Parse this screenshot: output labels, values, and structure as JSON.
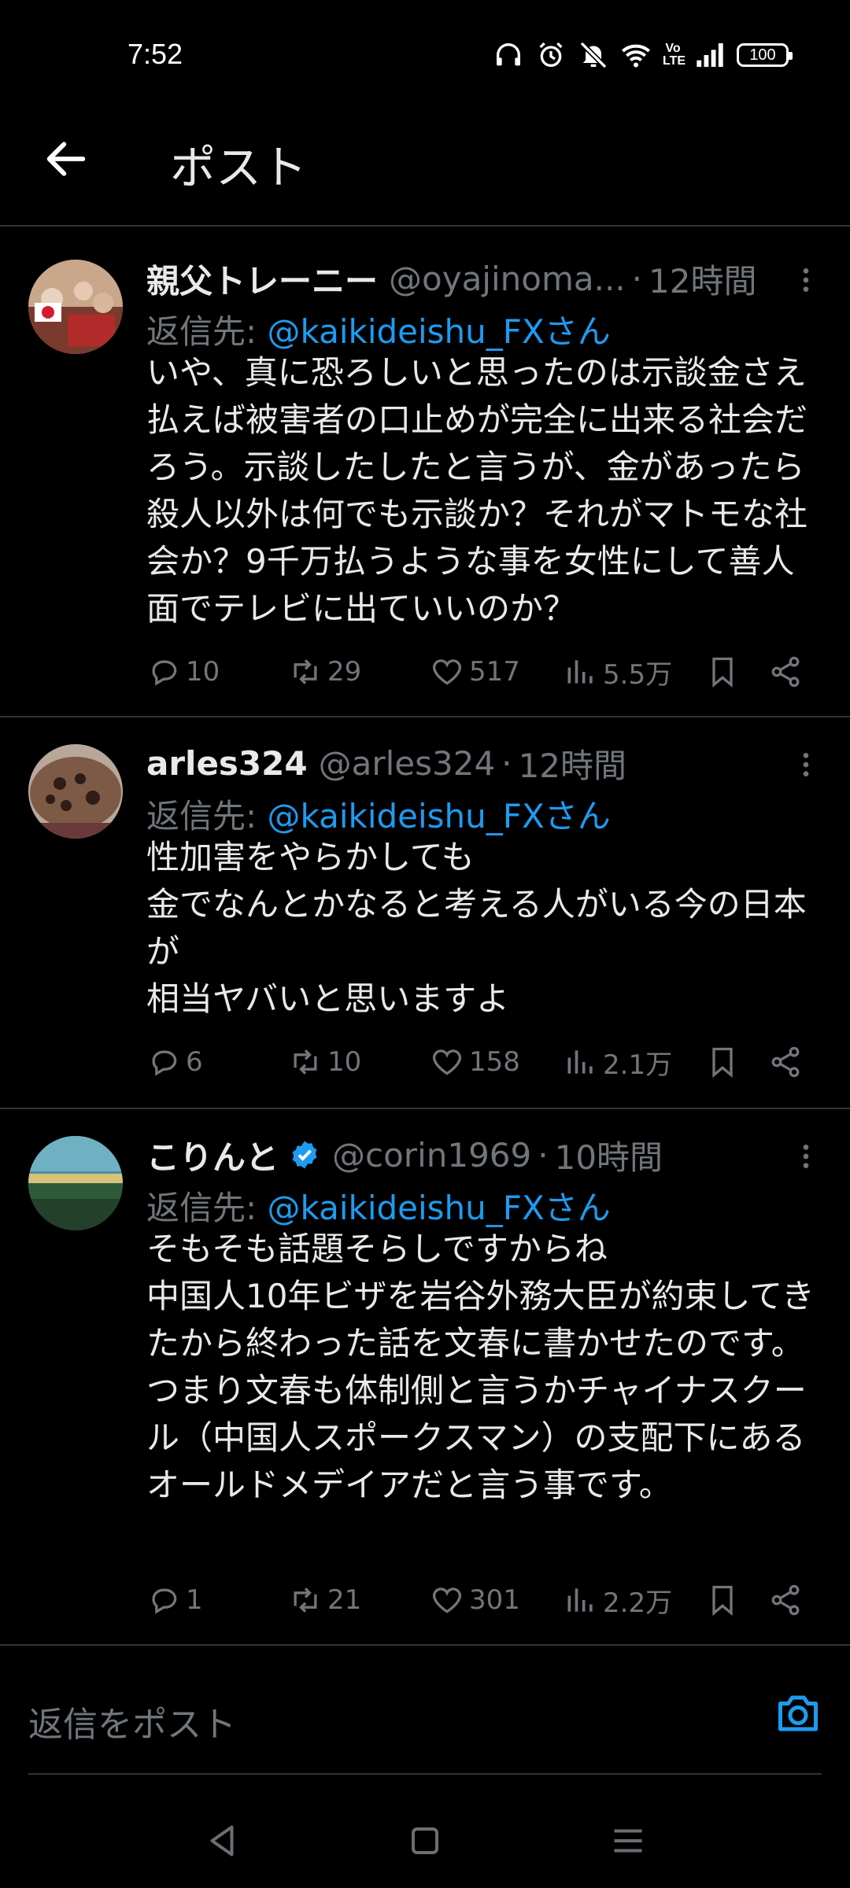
{
  "status_bar": {
    "time": "7:52",
    "volte": "Vo LTE",
    "battery": "100",
    "icons": [
      "headphones-icon",
      "alarm-icon",
      "mute-icon",
      "wifi-icon",
      "volte-icon",
      "signal-icon",
      "battery-icon"
    ]
  },
  "header": {
    "title": "ポスト",
    "back_icon": "arrow-left-icon"
  },
  "posts": [
    {
      "name": "親父トレーニー",
      "handle": "@oyajinoma...",
      "dot": "·",
      "time": "12時間",
      "reply_prefix": "返信先: ",
      "reply_to": "@kaikideishu_FXさん",
      "text": "いや、真に恐ろしいと思ったのは示談金さえ払えば被害者の口止めが完全に出来る社会だろう。示談したしたと言うが、金があったら殺人以外は何でも示談か？それがマトモな社会か？9千万払うような事を女性にして善人面でテレビに出ていいのか？",
      "replies": "10",
      "reposts": "29",
      "likes": "517",
      "views": "5.5万"
    },
    {
      "name": "arles324",
      "handle": "@arles324",
      "dot": "·",
      "time": "12時間",
      "reply_prefix": "返信先: ",
      "reply_to": "@kaikideishu_FXさん",
      "text": "性加害をやらかしても\n金でなんとかなると考える人がいる今の日本が\n相当ヤバいと思いますよ",
      "replies": "6",
      "reposts": "10",
      "likes": "158",
      "views": "2.1万"
    },
    {
      "name": "こりんと",
      "handle": "@corin1969",
      "dot": "·",
      "time": "10時間",
      "reply_prefix": "返信先: ",
      "reply_to": "@kaikideishu_FXさん",
      "text": "そもそも話題そらしですからね\n中国人10年ビザを岩谷外務大臣が約束してきたから終わった話を文春に書かせたのです。　つまり文春も体制側と言うかチャイナスクール（中国人スポークスマン）の支配下にあるオールドメデイアだと言う事です。",
      "replies": "1",
      "reposts": "21",
      "likes": "301",
      "views": "2.2万"
    }
  ],
  "composer": {
    "placeholder": "返信をポスト",
    "camera_icon": "camera-icon"
  },
  "colors": {
    "background": "#000000",
    "text": "#e7e9ea",
    "secondary": "#71767b",
    "accent": "#1d9bf0",
    "divider": "#2f3336"
  },
  "nav": {
    "icons": [
      "nav-back-icon",
      "nav-home-icon",
      "nav-recents-icon"
    ]
  }
}
